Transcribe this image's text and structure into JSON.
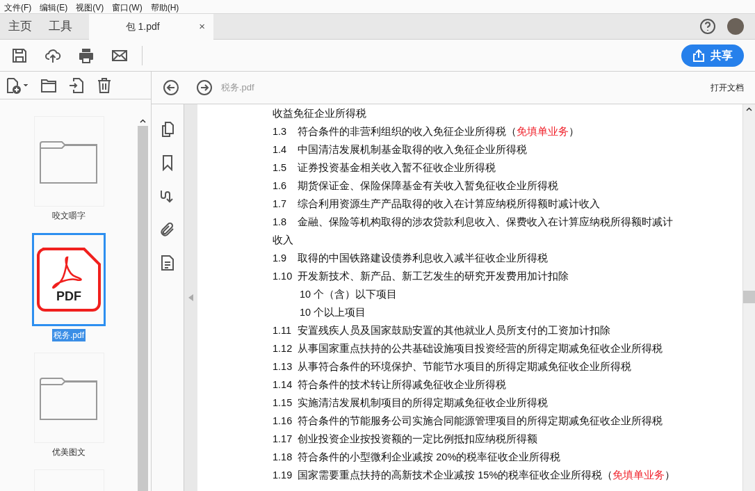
{
  "menu": [
    "文件(F)",
    "编辑(E)",
    "视图(V)",
    "窗口(W)",
    "帮助(H)"
  ],
  "tabs": [
    {
      "label": "主页",
      "kind": "nav",
      "selected": false
    },
    {
      "label": "工具",
      "kind": "nav",
      "selected": false
    },
    {
      "label": "包 1.pdf",
      "kind": "document",
      "selected": true,
      "close": "×"
    }
  ],
  "share_button": "共享",
  "files": [
    {
      "name": "咬文嚼字",
      "kind": "folder",
      "selected": false
    },
    {
      "name": "税务.pdf",
      "kind": "pdf",
      "selected": true,
      "badge": "PDF"
    },
    {
      "name": "优美图文",
      "kind": "folder",
      "selected": false
    },
    {
      "kind": "partial",
      "selected": false
    }
  ],
  "document": {
    "filename": "税务.pdf",
    "open_link": "打开文档",
    "lines": [
      {
        "kind": "continuation",
        "text": "收益免征企业所得税"
      },
      {
        "kind": "item",
        "number": "1.3",
        "text": "符合条件的非营利组织的收入免征企业所得税（",
        "note": "免填单业务",
        "tail": "）"
      },
      {
        "kind": "item",
        "number": "1.4",
        "text": "中国清洁发展机制基金取得的收入免征企业所得税"
      },
      {
        "kind": "item",
        "number": "1.5",
        "text": "证券投资基金相关收入暂不征收企业所得税"
      },
      {
        "kind": "item",
        "number": "1.6",
        "text": "期货保证金、保险保障基金有关收入暂免征收企业所得税"
      },
      {
        "kind": "item",
        "number": "1.7",
        "text": "综合利用资源生产产品取得的收入在计算应纳税所得额时减计收入"
      },
      {
        "kind": "item",
        "number": "1.8",
        "text": "金融、保险等机构取得的涉农贷款利息收入、保费收入在计算应纳税所得额时减计"
      },
      {
        "kind": "continuation",
        "text": "收入"
      },
      {
        "kind": "item",
        "number": "1.9",
        "text": "取得的中国铁路建设债券利息收入减半征收企业所得税"
      },
      {
        "kind": "item",
        "number": "1.10",
        "text": "开发新技术、新产品、新工艺发生的研究开发费用加计扣除"
      },
      {
        "kind": "subitem",
        "text": "10 个（含）以下项目"
      },
      {
        "kind": "subitem",
        "text": "10 个以上项目"
      },
      {
        "kind": "item",
        "number": "1.11",
        "text": "安置残疾人员及国家鼓励安置的其他就业人员所支付的工资加计扣除"
      },
      {
        "kind": "item",
        "number": "1.12",
        "text": "从事国家重点扶持的公共基础设施项目投资经营的所得定期减免征收企业所得税"
      },
      {
        "kind": "item",
        "number": "1.13",
        "text": "从事符合条件的环境保护、节能节水项目的所得定期减免征收企业所得税"
      },
      {
        "kind": "item",
        "number": "1.14",
        "text": "符合条件的技术转让所得减免征收企业所得税"
      },
      {
        "kind": "item",
        "number": "1.15",
        "text": "实施清洁发展机制项目的所得定期减免征收企业所得税"
      },
      {
        "kind": "item",
        "number": "1.16",
        "text": "符合条件的节能服务公司实施合同能源管理项目的所得定期减免征收企业所得税"
      },
      {
        "kind": "item",
        "number": "1.17",
        "text": "创业投资企业按投资额的一定比例抵扣应纳税所得额"
      },
      {
        "kind": "item",
        "number": "1.18",
        "text": "符合条件的小型微利企业减按 20%的税率征收企业所得税"
      },
      {
        "kind": "item",
        "number": "1.19",
        "text": "国家需要重点扶持的高新技术企业减按 15%的税率征收企业所得税（",
        "note": "免填单业务",
        "tail": "）"
      }
    ]
  }
}
